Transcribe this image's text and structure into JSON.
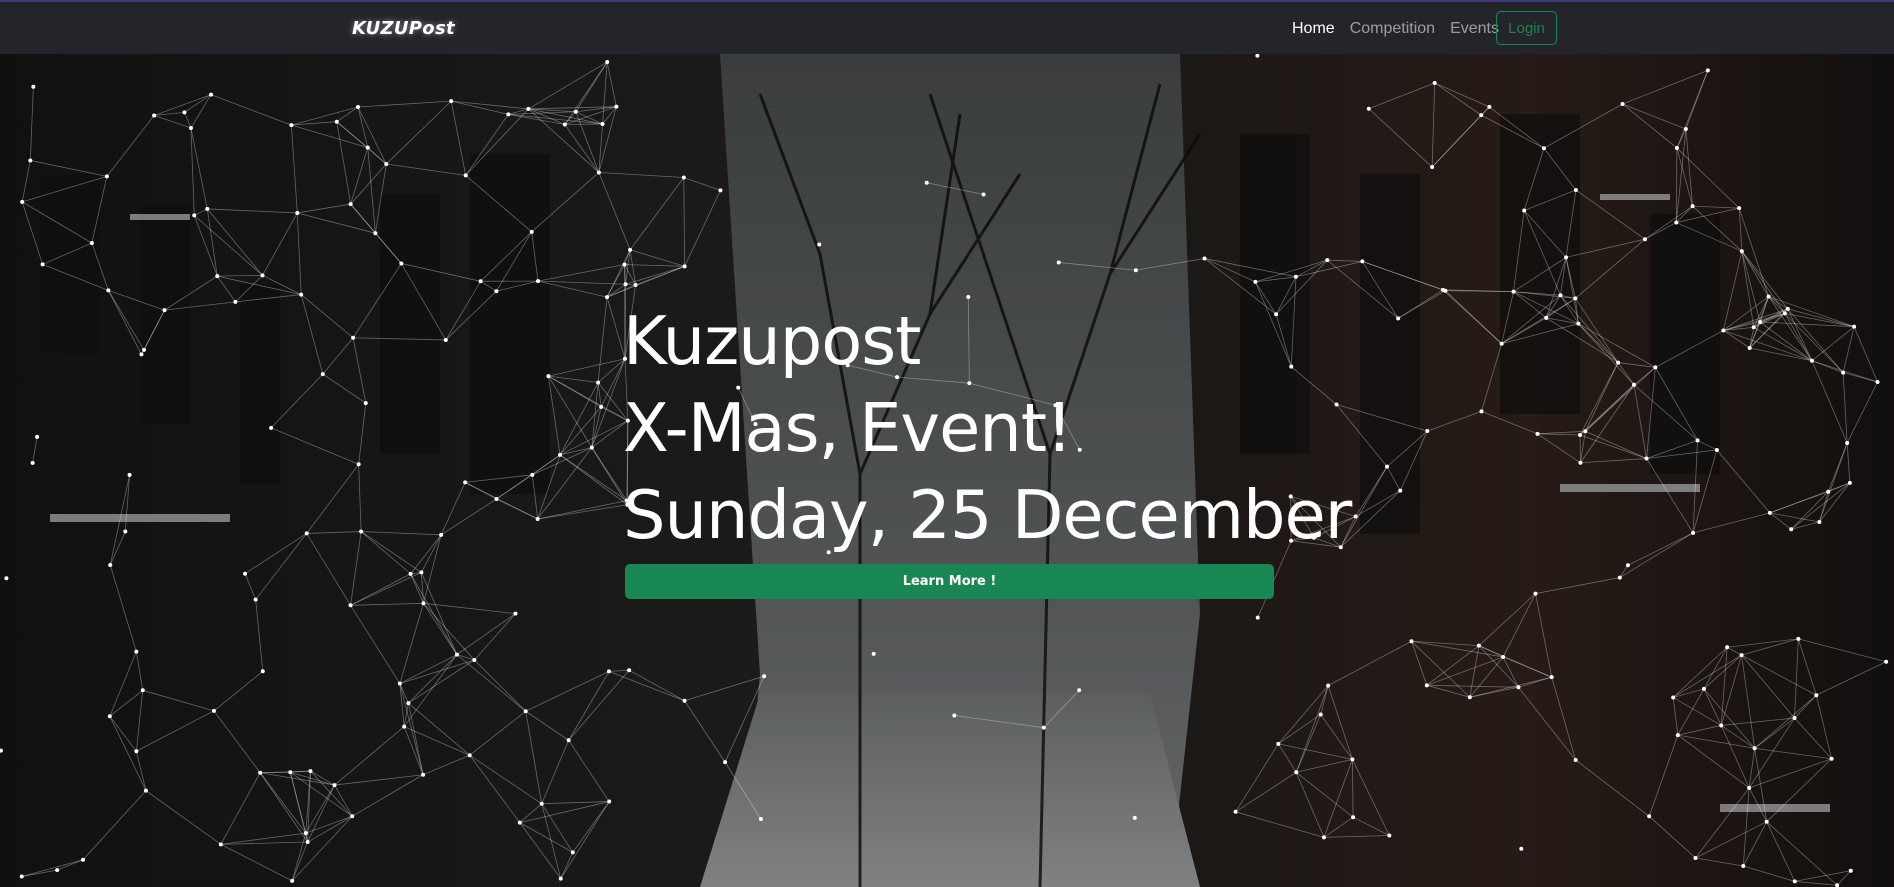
{
  "navbar": {
    "brand": "KUZUPost",
    "links": [
      {
        "label": "Home",
        "active": true
      },
      {
        "label": "Competition",
        "active": false
      },
      {
        "label": "Events",
        "active": false
      }
    ],
    "login_label": "Login"
  },
  "hero": {
    "line1": "Kuzupost",
    "line2": "X-Mas, Event!",
    "line3": "Sunday, 25 December",
    "button_label": "Learn More !"
  },
  "colors": {
    "accent": "#198754",
    "navbar_bg": "#23252b",
    "text": "#ffffff"
  }
}
